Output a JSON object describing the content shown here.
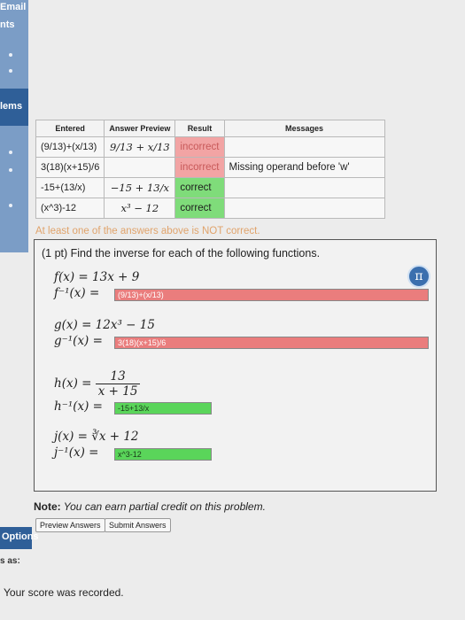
{
  "sidebar": {
    "email_label": "Email",
    "nts_label": "nts",
    "problems_label": "lems"
  },
  "options": {
    "label": "Options",
    "sub_label": "s as:"
  },
  "results_table": {
    "headers": [
      "Entered",
      "Answer Preview",
      "Result",
      "Messages"
    ],
    "rows": [
      {
        "entered": "(9/13)+(x/13)",
        "preview": "9/13 + x/13",
        "result": "incorrect",
        "message": ""
      },
      {
        "entered": "3(18)(x+15)/6",
        "preview": "",
        "result": "incorrect",
        "message": "Missing operand before 'w'"
      },
      {
        "entered": "-15+(13/x)",
        "preview": "−15 + 13/x",
        "result": "correct",
        "message": ""
      },
      {
        "entered": "(x^3)-12",
        "preview": "x³ − 12",
        "result": "correct",
        "message": ""
      }
    ]
  },
  "warning": "At least one of the answers above is NOT correct.",
  "problem": {
    "prompt": "(1 pt) Find the inverse for each of the following functions.",
    "functions": [
      {
        "def": "f(x) = 13x + 9",
        "inv_label": "f⁻¹(x) =",
        "answer": "(9/13)+(x/13)",
        "status": "incorrect"
      },
      {
        "def": "g(x) = 12x³ − 15",
        "inv_label": "g⁻¹(x) =",
        "answer": "3(18)(x+15)/6",
        "status": "incorrect"
      },
      {
        "def_prefix": "h(x) =",
        "def_num": "13",
        "def_den": "x + 15",
        "inv_label": "h⁻¹(x) =",
        "answer": "-15+13/x",
        "status": "correct"
      },
      {
        "def": "j(x) = ∛x + 12",
        "inv_label": "j⁻¹(x) =",
        "answer": "x^3-12",
        "status": "correct"
      }
    ],
    "pi_icon": "π"
  },
  "note": {
    "bold": "Note:",
    "text": " You can earn partial credit on this problem."
  },
  "buttons": {
    "preview": "Preview Answers",
    "submit": "Submit Answers"
  },
  "score_text": "Your score was recorded.",
  "colors": {
    "incorrect": "#ea7d7d",
    "correct": "#5ad55a",
    "accent": "#2f5f98"
  }
}
